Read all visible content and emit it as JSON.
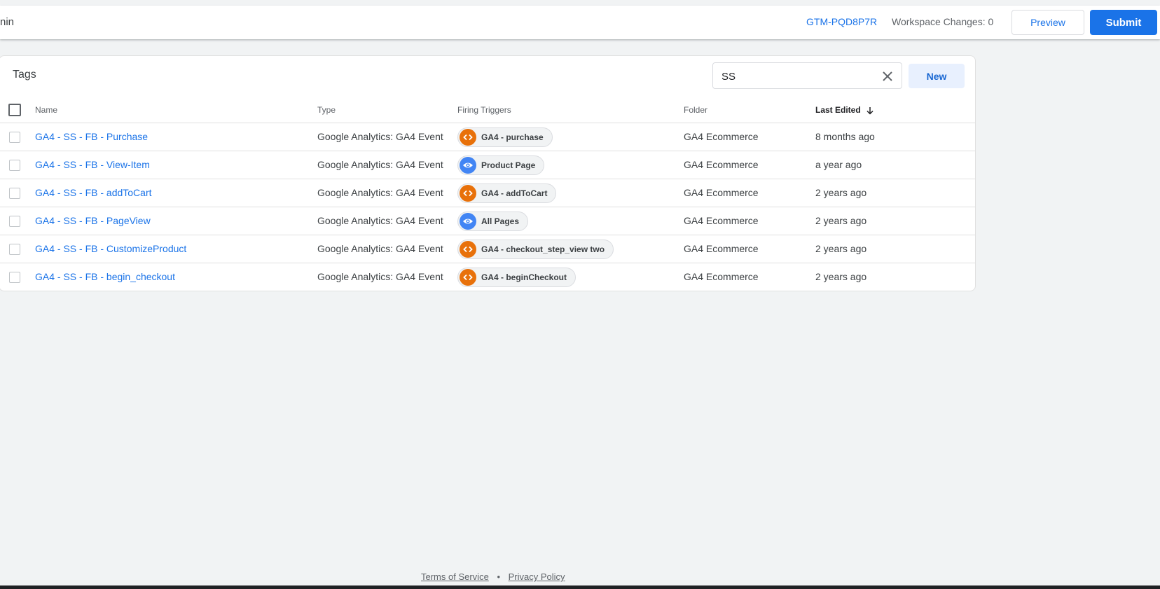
{
  "header": {
    "left_text": "nin",
    "container_id": "GTM-PQD8P7R",
    "workspace_changes": "Workspace Changes: 0",
    "preview_label": "Preview",
    "submit_label": "Submit"
  },
  "tags_panel": {
    "title": "Tags",
    "search_value": "SS",
    "new_label": "New",
    "columns": {
      "name": "Name",
      "type": "Type",
      "firing_triggers": "Firing Triggers",
      "folder": "Folder",
      "last_edited": "Last Edited"
    },
    "rows": [
      {
        "name": "GA4 - SS - FB - Purchase",
        "type": "Google Analytics: GA4 Event",
        "trigger": {
          "icon": "code-icon",
          "label": "GA4 - purchase"
        },
        "folder": "GA4 Ecommerce",
        "last_edited": "8 months ago"
      },
      {
        "name": "GA4 - SS - FB - View-Item",
        "type": "Google Analytics: GA4 Event",
        "trigger": {
          "icon": "eye-icon",
          "label": "Product Page"
        },
        "folder": "GA4 Ecommerce",
        "last_edited": "a year ago"
      },
      {
        "name": "GA4 - SS - FB - addToCart",
        "type": "Google Analytics: GA4 Event",
        "trigger": {
          "icon": "code-icon",
          "label": "GA4 - addToCart"
        },
        "folder": "GA4 Ecommerce",
        "last_edited": "2 years ago"
      },
      {
        "name": "GA4 - SS - FB - PageView",
        "type": "Google Analytics: GA4 Event",
        "trigger": {
          "icon": "eye-icon",
          "label": "All Pages"
        },
        "folder": "GA4 Ecommerce",
        "last_edited": "2 years ago"
      },
      {
        "name": "GA4 - SS - FB - CustomizeProduct",
        "type": "Google Analytics: GA4 Event",
        "trigger": {
          "icon": "code-icon",
          "label": "GA4 - checkout_step_view two"
        },
        "folder": "GA4 Ecommerce",
        "last_edited": "2 years ago"
      },
      {
        "name": "GA4 - SS - FB - begin_checkout",
        "type": "Google Analytics: GA4 Event",
        "trigger": {
          "icon": "code-icon",
          "label": "GA4 - beginCheckout"
        },
        "folder": "GA4 Ecommerce",
        "last_edited": "2 years ago"
      }
    ]
  },
  "footer": {
    "terms": "Terms of Service",
    "separator": "•",
    "privacy": "Privacy Policy"
  },
  "colors": {
    "accent": "#1a73e8",
    "code_trigger": "#e8710a",
    "view_trigger": "#4285f4"
  }
}
